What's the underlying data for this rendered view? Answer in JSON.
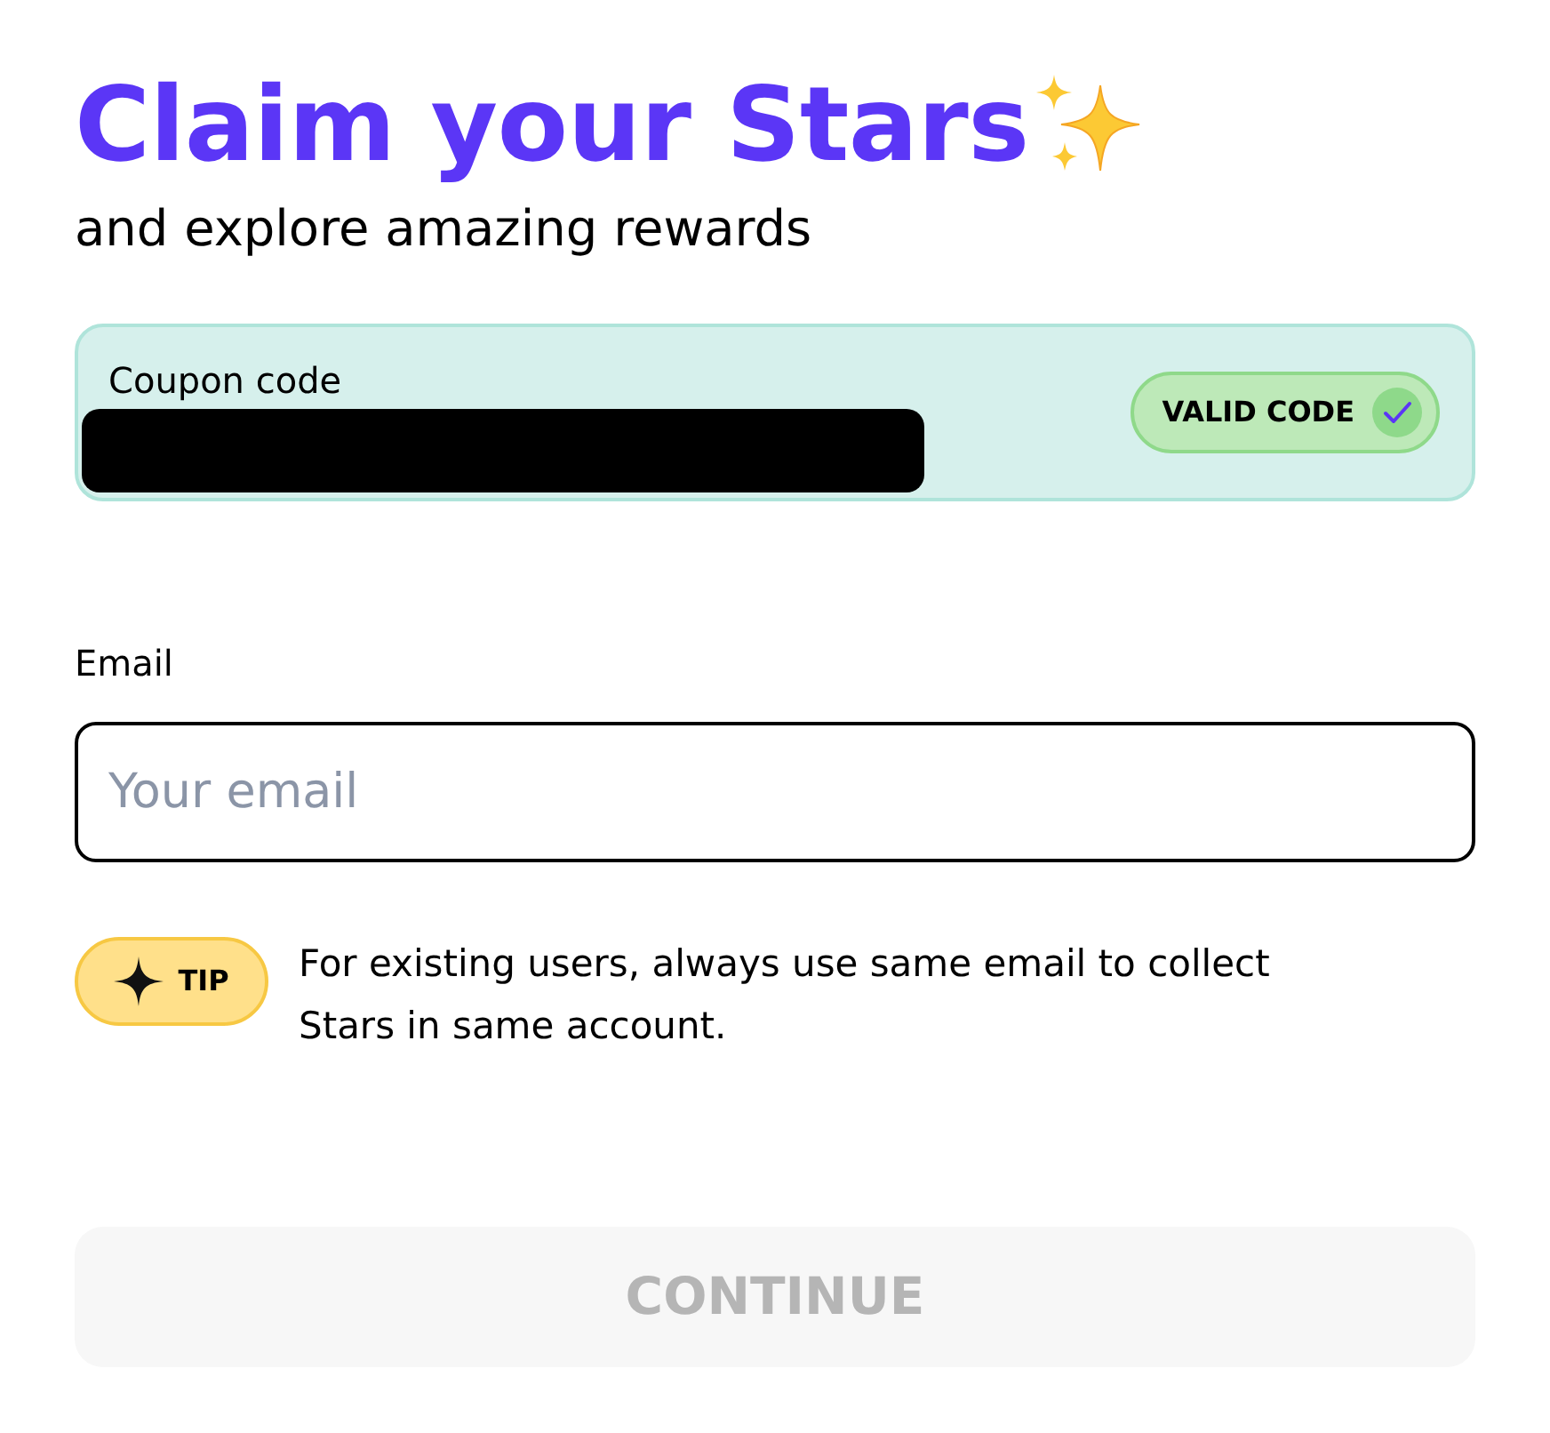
{
  "heading": {
    "title": "Claim your Stars",
    "subtitle": "and explore amazing rewards"
  },
  "coupon": {
    "label": "Coupon code",
    "value_redacted": true,
    "status": {
      "label": "VALID CODE",
      "valid": true
    }
  },
  "email": {
    "label": "Email",
    "placeholder": "Your email"
  },
  "tip": {
    "badge": "TIP",
    "text": "For existing users, always use same email to collect Stars in same account."
  },
  "continue_button": {
    "label": "CONTINUE",
    "disabled": true
  }
}
